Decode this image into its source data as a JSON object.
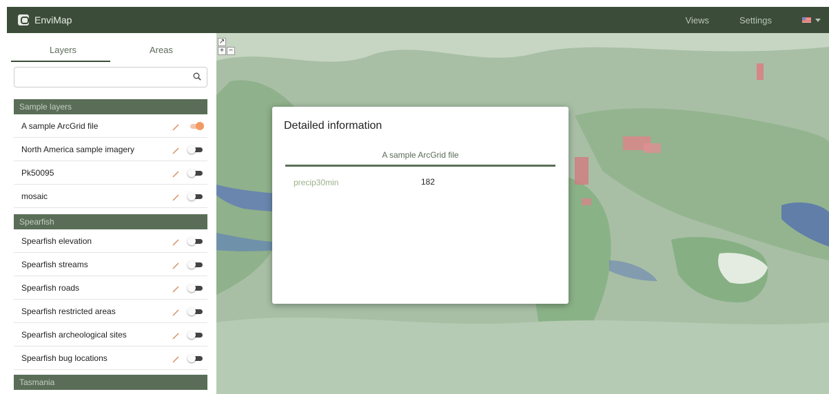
{
  "app": {
    "name": "EnviMap"
  },
  "nav": {
    "views": "Views",
    "settings": "Settings"
  },
  "sidebar": {
    "tabs": [
      {
        "label": "Layers",
        "active": true
      },
      {
        "label": "Areas",
        "active": false
      }
    ],
    "search": {
      "value": "",
      "placeholder": ""
    },
    "groups": [
      {
        "title": "Sample layers",
        "layers": [
          {
            "name": "A sample ArcGrid file",
            "visible": true
          },
          {
            "name": "North America sample imagery",
            "visible": false
          },
          {
            "name": "Pk50095",
            "visible": false
          },
          {
            "name": "mosaic",
            "visible": false
          }
        ]
      },
      {
        "title": "Spearfish",
        "layers": [
          {
            "name": "Spearfish elevation",
            "visible": false
          },
          {
            "name": "Spearfish streams",
            "visible": false
          },
          {
            "name": "Spearfish roads",
            "visible": false
          },
          {
            "name": "Spearfish restricted areas",
            "visible": false
          },
          {
            "name": "Spearfish archeological sites",
            "visible": false
          },
          {
            "name": "Spearfish bug locations",
            "visible": false
          }
        ]
      },
      {
        "title": "Tasmania",
        "layers": []
      }
    ]
  },
  "map": {
    "zoom_in": "+",
    "zoom_out": "−"
  },
  "modal": {
    "title": "Detailed information",
    "layer": "A sample ArcGrid file",
    "rows": [
      {
        "key": "precip30min",
        "value": "182"
      }
    ]
  },
  "colors": {
    "header": "#3b4d39",
    "group": "#5a6e57",
    "toggle_on": "#f29a64"
  }
}
